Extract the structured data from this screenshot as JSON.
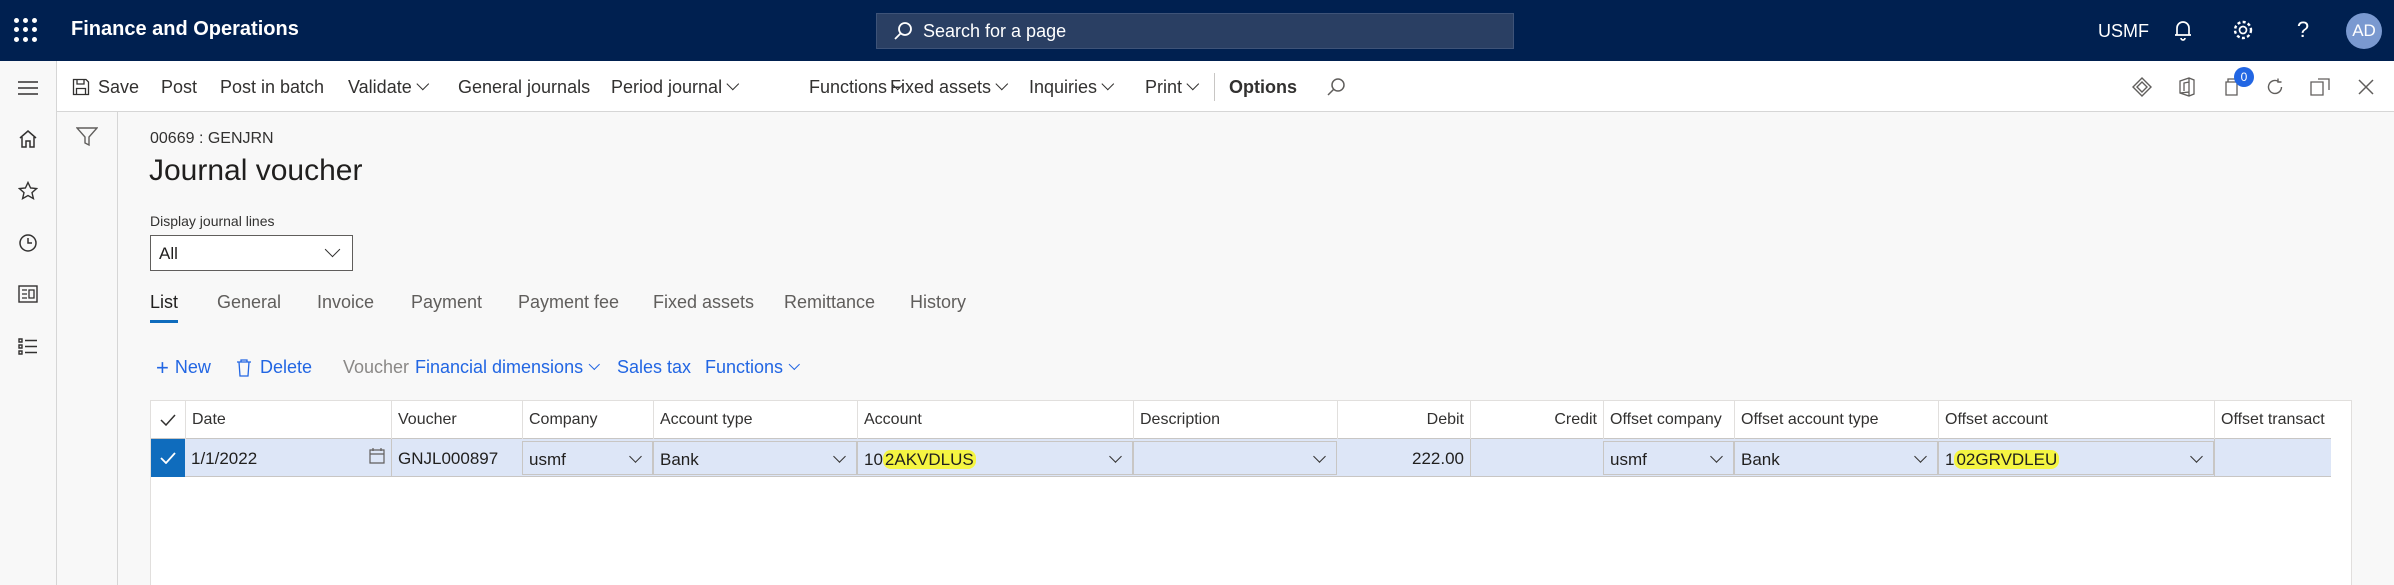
{
  "topbar": {
    "app_title": "Finance and Operations",
    "search_placeholder": "Search for a page",
    "company": "USMF",
    "avatar_initials": "AD"
  },
  "action_pane": {
    "save": "Save",
    "post": "Post",
    "post_in_batch": "Post in batch",
    "validate": "Validate",
    "general_journals": "General journals",
    "period_journal": "Period journal",
    "functions": "Functions",
    "fixed_assets": "Fixed assets",
    "inquiries": "Inquiries",
    "print": "Print",
    "options": "Options",
    "notification_count": "0"
  },
  "page": {
    "caption": "00669 : GENJRN",
    "title": "Journal voucher",
    "display_lines_label": "Display journal lines",
    "display_lines_value": "All"
  },
  "tabs": [
    "List",
    "General",
    "Invoice",
    "Payment",
    "Payment fee",
    "Fixed assets",
    "Remittance",
    "History"
  ],
  "grid_commands": {
    "new": "New",
    "delete": "Delete",
    "voucher": "Voucher",
    "financial_dimensions": "Financial dimensions",
    "sales_tax": "Sales tax",
    "functions": "Functions"
  },
  "grid": {
    "columns": [
      "Date",
      "Voucher",
      "Company",
      "Account type",
      "Account",
      "Description",
      "Debit",
      "Credit",
      "Offset company",
      "Offset account type",
      "Offset account",
      "Offset transact"
    ],
    "row": {
      "date": "1/1/2022",
      "voucher": "GNJL000897",
      "company": "usmf",
      "account_type": "Bank",
      "account_prefix": "10",
      "account_highlight": "2AKVDLUS",
      "description": "",
      "debit": "222.00",
      "credit": "",
      "offset_company": "usmf",
      "offset_account_type": "Bank",
      "offset_account_prefix": "1",
      "offset_account_highlight": "02GRVDLEU"
    }
  },
  "colors": {
    "navy": "#002050",
    "accent": "#0f6cbd",
    "link": "#2266e3",
    "highlight": "#f5f542",
    "selected_row": "#dde6f7"
  }
}
